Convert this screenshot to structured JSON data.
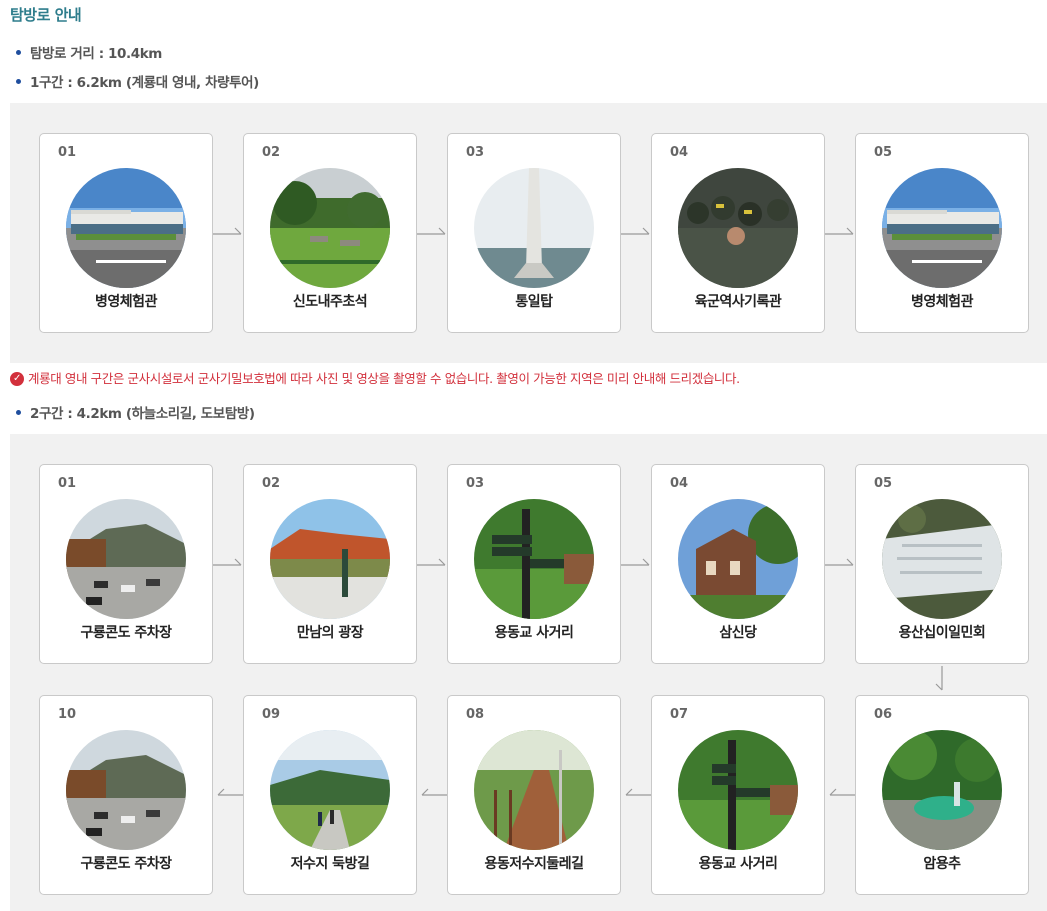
{
  "title": "탐방로 안내",
  "info": {
    "distance": "탐방로 거리 : 10.4km",
    "section1": "1구간 : 6.2km (계룡대 영내, 차량투어)",
    "section2": "2구간 : 4.2km (하늘소리길, 도보탐방)"
  },
  "notice": "계룡대 영내 구간은 군사시설로서 군사기밀보호법에 따라 사진 및 영상을 촬영할 수 없습니다. 촬영이 가능한 지역은 미리 안내해 드리겠습니다.",
  "section1_stops": [
    {
      "num": "01",
      "name": "병영체험관",
      "icon": "museum-building-photo"
    },
    {
      "num": "02",
      "name": "신도내주초석",
      "icon": "foundation-stones-photo"
    },
    {
      "num": "03",
      "name": "통일탑",
      "icon": "unification-tower-photo"
    },
    {
      "num": "04",
      "name": "육군역사기록관",
      "icon": "soldiers-photo"
    },
    {
      "num": "05",
      "name": "병영체험관",
      "icon": "museum-building-photo"
    }
  ],
  "section2_stops": [
    {
      "num": "01",
      "name": "구룡콘도 주차장",
      "icon": "parking-lot-photo"
    },
    {
      "num": "02",
      "name": "만남의 광장",
      "icon": "plaza-photo"
    },
    {
      "num": "03",
      "name": "용동교 사거리",
      "icon": "signpost-photo"
    },
    {
      "num": "04",
      "name": "삼신당",
      "icon": "shrine-photo"
    },
    {
      "num": "05",
      "name": "용산십이일민회",
      "icon": "rock-carving-photo"
    },
    {
      "num": "06",
      "name": "암용추",
      "icon": "pool-photo"
    },
    {
      "num": "07",
      "name": "용동교 사거리",
      "icon": "signpost-photo"
    },
    {
      "num": "08",
      "name": "용동저수지둘레길",
      "icon": "trail-photo"
    },
    {
      "num": "09",
      "name": "저수지 둑방길",
      "icon": "embankment-photo"
    },
    {
      "num": "10",
      "name": "구룡콘도 주차장",
      "icon": "parking-lot-photo"
    }
  ]
}
